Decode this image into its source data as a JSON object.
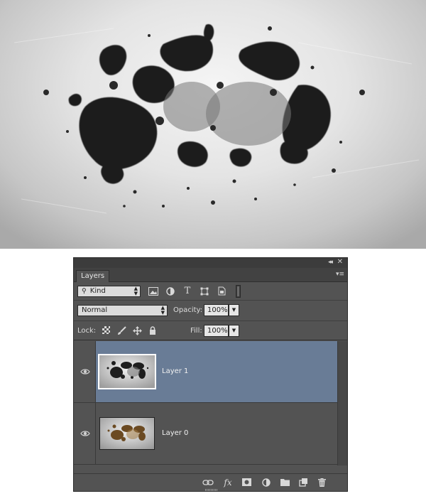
{
  "panel": {
    "tab_label": "Layers",
    "collapse_glyph": "◂◂",
    "close_glyph": "✕",
    "menu_glyph": "▾≡"
  },
  "filter": {
    "kind_label": "Kind",
    "search_glyph": "⚲"
  },
  "blend": {
    "mode": "Normal",
    "opacity_label": "Opacity:",
    "opacity_value": "100%"
  },
  "lock": {
    "label": "Lock:",
    "fill_label": "Fill:",
    "fill_value": "100%"
  },
  "layers": [
    {
      "name": "Layer 1",
      "selected": true,
      "visible": true
    },
    {
      "name": "Layer 0",
      "selected": false,
      "visible": true
    }
  ],
  "toolbar": {
    "fx_label": "fx"
  },
  "colors": {
    "panel_bg": "#535353",
    "selected_row": "#697c96"
  }
}
